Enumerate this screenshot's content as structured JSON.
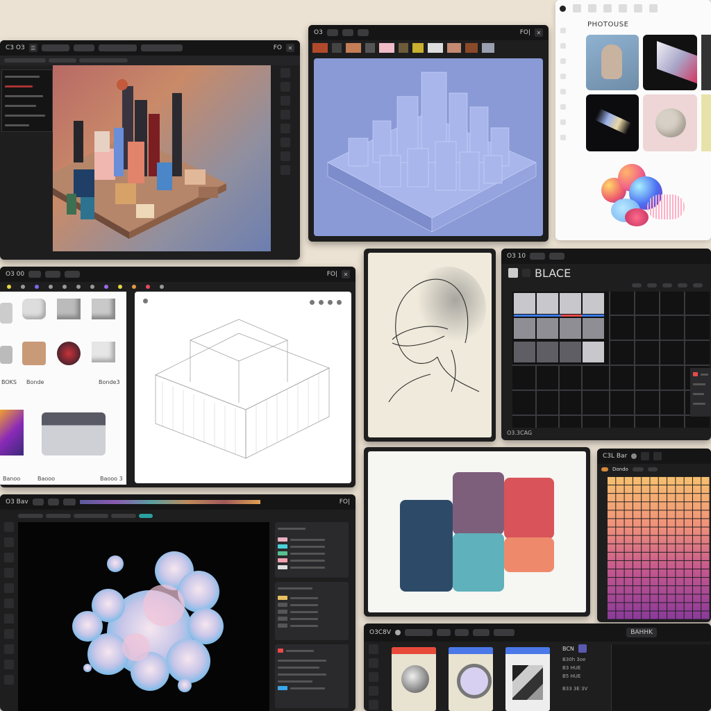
{
  "windows": {
    "city": {
      "title": "C3 O3",
      "right": "FO"
    },
    "wire": {
      "title": "O3",
      "right": "FO|"
    },
    "gallery": {
      "title": "PHOTOUSE"
    },
    "library": {
      "title": "O3 00",
      "right": "FO|",
      "labels": [
        "BOKS",
        "Bonde",
        "Bonde3",
        "Banoo",
        "Baooo",
        "Baooo 3"
      ]
    },
    "sketch": {},
    "grid": {
      "title": "O3 10",
      "toolbar_label": "BLACE",
      "footer": "O3.3CAG"
    },
    "palette": {
      "colors": [
        "#2d4b68",
        "#7d5f7c",
        "#d9535a",
        "#5fb1bb",
        "#ee8a6b"
      ]
    },
    "gradient": {
      "title": "C3L Bar",
      "sub": "Dondo"
    },
    "blob": {
      "title": "O3 Bav",
      "right": "FO|"
    },
    "bottom": {
      "title": "O3C8V",
      "tag": "BAHHK",
      "side_title": "BCN",
      "side_lines": [
        "B30h 3oe",
        "B3 HUE",
        "B5 HUE"
      ],
      "footer": "B33 3E 3V"
    }
  },
  "icons": [
    "close-icon",
    "menu-icon",
    "gear-icon",
    "layers-icon",
    "brush-icon",
    "eye-icon"
  ]
}
